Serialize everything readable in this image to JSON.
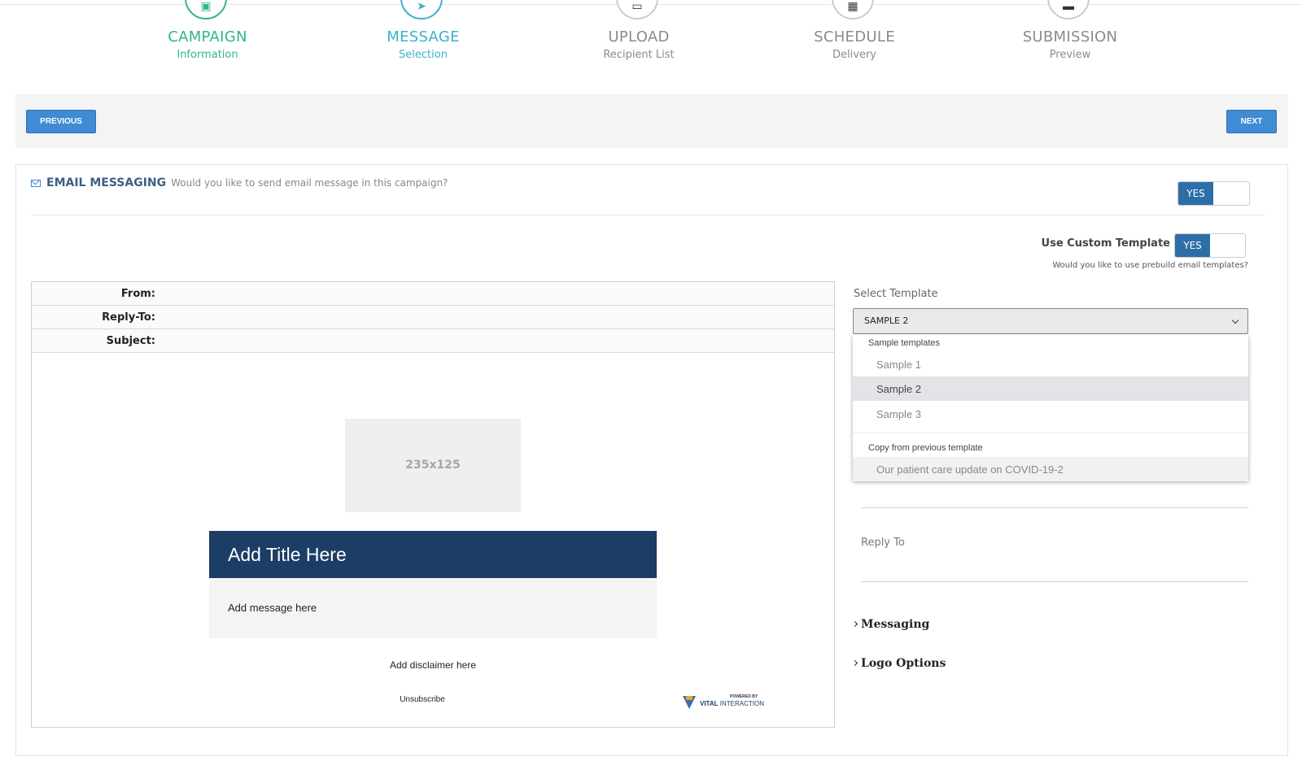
{
  "steps": [
    {
      "title": "CAMPAIGN",
      "sub": "Information",
      "state": "done",
      "icon": "id-card-icon"
    },
    {
      "title": "MESSAGE",
      "sub": "Selection",
      "state": "active",
      "icon": "paper-plane-icon"
    },
    {
      "title": "UPLOAD",
      "sub": "Recipient List",
      "state": "todo",
      "icon": "upload-icon"
    },
    {
      "title": "SCHEDULE",
      "sub": "Delivery",
      "state": "todo",
      "icon": "calendar-icon"
    },
    {
      "title": "SUBMISSION",
      "sub": "Preview",
      "state": "todo",
      "icon": "monitor-icon"
    }
  ],
  "nav": {
    "previous": "PREVIOUS",
    "next": "NEXT"
  },
  "email": {
    "title": "EMAIL MESSAGING",
    "question": "Would you like to send email message in this campaign?",
    "toggle": "YES",
    "custom_label": "Use Custom Template",
    "custom_toggle": "YES",
    "custom_question": "Would you like to use prebuild email templates?"
  },
  "preview": {
    "from_label": "From:",
    "reply_label": "Reply-To:",
    "subject_label": "Subject:",
    "image_placeholder": "235x125",
    "title": "Add Title Here",
    "message": "Add message here",
    "disclaimer": "Add disclaimer here",
    "unsubscribe": "Unsubscribe",
    "logo_powered": "POWERED BY",
    "logo_name_bold": "VITAL",
    "logo_name": "INTERACTION"
  },
  "template": {
    "label": "Select Template",
    "selected": "SAMPLE 2",
    "group1": "Sample templates",
    "options": [
      "Sample 1",
      "Sample 2",
      "Sample 3"
    ],
    "group2": "Copy from previous template",
    "previous": "Our patient care update on COVID-19-2"
  },
  "right": {
    "reply_to": "Reply To",
    "messaging": "Messaging",
    "logo_options": "Logo Options"
  },
  "colors": {
    "done": "#2fb589",
    "active": "#3ab3c8",
    "button": "#3f8bd4",
    "title_bar": "#1c3d66",
    "toggle": "#2e6ea8"
  }
}
